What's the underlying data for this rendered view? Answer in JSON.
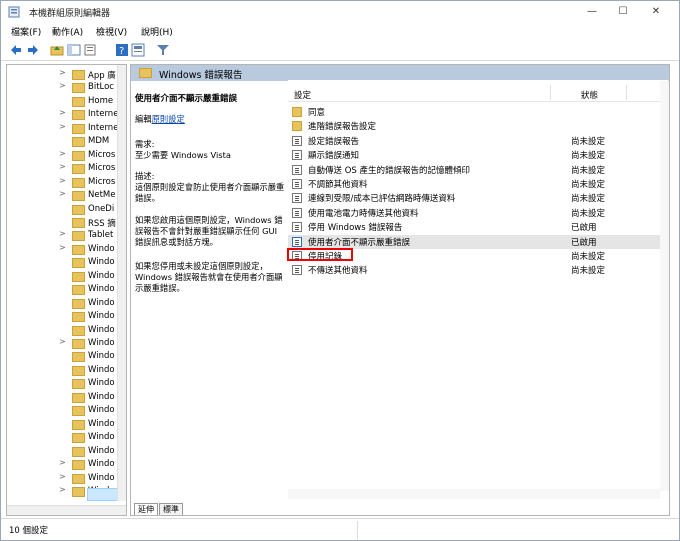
{
  "window": {
    "title": "本機群組原則編輯器",
    "min": "—",
    "max": "☐",
    "close": "✕"
  },
  "menu": [
    "檔案(F)",
    "動作(A)",
    "檢視(V)",
    "說明(H)"
  ],
  "toolbar": [
    "back-icon",
    "forward-icon",
    "up-icon",
    "show-tree-icon",
    "export-icon",
    "help-icon",
    "properties-icon",
    "filter-icon"
  ],
  "tree": {
    "items": [
      {
        "label": "App 廣",
        "arrow": ">"
      },
      {
        "label": "BitLoc",
        "arrow": ">"
      },
      {
        "label": "Home",
        "arrow": ""
      },
      {
        "label": "Interne",
        "arrow": ">"
      },
      {
        "label": "Interne",
        "arrow": ">"
      },
      {
        "label": "MDM",
        "arrow": ""
      },
      {
        "label": "Micros",
        "arrow": ">"
      },
      {
        "label": "Micros",
        "arrow": ">"
      },
      {
        "label": "Micros",
        "arrow": ">"
      },
      {
        "label": "NetMe",
        "arrow": ">"
      },
      {
        "label": "OneDi",
        "arrow": ""
      },
      {
        "label": "RSS 摘",
        "arrow": ""
      },
      {
        "label": "Tablet",
        "arrow": ">"
      },
      {
        "label": "Windo",
        "arrow": ">"
      },
      {
        "label": "Windo",
        "arrow": ""
      },
      {
        "label": "Windo",
        "arrow": ""
      },
      {
        "label": "Windo",
        "arrow": ""
      },
      {
        "label": "Windo",
        "arrow": ""
      },
      {
        "label": "Windo",
        "arrow": ""
      },
      {
        "label": "Windo",
        "arrow": ""
      },
      {
        "label": "Windo",
        "arrow": ">"
      },
      {
        "label": "Windo",
        "arrow": ""
      },
      {
        "label": "Windo",
        "arrow": ""
      },
      {
        "label": "Windo",
        "arrow": ""
      },
      {
        "label": "Windo",
        "arrow": ""
      },
      {
        "label": "Windo",
        "arrow": ""
      },
      {
        "label": "Windo",
        "arrow": ""
      },
      {
        "label": "Windo",
        "arrow": ""
      },
      {
        "label": "Windo",
        "arrow": ""
      },
      {
        "label": "Windo",
        "arrow": ">"
      },
      {
        "label": "Windo",
        "arrow": ">"
      },
      {
        "label": "Windo",
        "arrow": ">"
      }
    ]
  },
  "panel": {
    "header": "Windows 錯誤報告",
    "desc_title": "使用者介面不顯示嚴重錯誤",
    "edit_prefix": "編輯",
    "edit_link": "原則設定",
    "req_label": "需求:",
    "req_value": "至少需要 Windows Vista",
    "desc_label": "描述:",
    "desc_text": "這個原則設定會防止使用者介面顯示嚴重錯誤。",
    "desc_enabled": "如果您啟用這個原則設定，Windows 錯誤報告不會針對嚴重錯誤顯示任何 GUI 錯誤訊息或對話方塊。",
    "desc_disabled": "如果您停用或未設定這個原則設定，Windows 錯誤報告就會在使用者介面顯示嚴重錯誤。"
  },
  "list": {
    "col_setting": "設定",
    "col_state": "狀態",
    "rows": [
      {
        "type": "folder",
        "name": "同意",
        "state": ""
      },
      {
        "type": "folder",
        "name": "進階錯誤報告設定",
        "state": ""
      },
      {
        "type": "policy",
        "name": "設定錯誤報告",
        "state": "尚未設定"
      },
      {
        "type": "policy",
        "name": "顯示錯誤通知",
        "state": "尚未設定"
      },
      {
        "type": "policy",
        "name": "自動傳送 OS 產生的錯誤報告的記憶體傾印",
        "state": "尚未設定"
      },
      {
        "type": "policy",
        "name": "不調節其他資料",
        "state": "尚未設定"
      },
      {
        "type": "policy",
        "name": "連線到受限/成本已評估網路時傳送資料",
        "state": "尚未設定"
      },
      {
        "type": "policy",
        "name": "使用電池電力時傳送其他資料",
        "state": "尚未設定"
      },
      {
        "type": "policy",
        "name": "停用 Windows 錯誤報告",
        "state": "已啟用"
      },
      {
        "type": "policy-on",
        "name": "使用者介面不顯示嚴重錯誤",
        "state": "已啟用"
      },
      {
        "type": "policy",
        "name": "停用記錄",
        "state": "尚未設定"
      },
      {
        "type": "policy",
        "name": "不傳送其他資料",
        "state": "尚未設定"
      }
    ]
  },
  "tabs": [
    "延伸",
    "標準"
  ],
  "status": "10 個設定"
}
